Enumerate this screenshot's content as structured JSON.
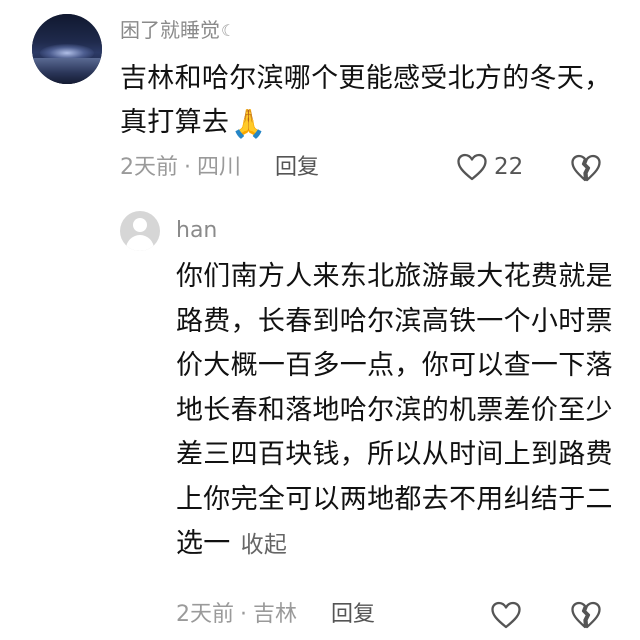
{
  "main_comment": {
    "username": "困了就睡觉",
    "username_icon": "crescent-moon-icon",
    "text": "吉林和哈尔滨哪个更能感受北方的冬天，真打算去",
    "emoji": "🙏",
    "time": "2天前",
    "location": "四川",
    "reply_label": "回复",
    "like_count": "22",
    "like_icon": "heart-outline-icon",
    "dislike_icon": "broken-heart-icon"
  },
  "reply_comment": {
    "username": "han",
    "text": "你们南方人来东北旅游最大花费就是路费，长春到哈尔滨高铁一个小时票价大概一百多一点，你可以查一下落地长春和落地哈尔滨的机票差价至少差三四百块钱，所以从时间上到路费上你完全可以两地都去不用纠结于二选一",
    "collapse_label": "收起",
    "time": "2天前",
    "location": "吉林",
    "reply_label": "回复",
    "like_icon": "heart-outline-icon",
    "dislike_icon": "broken-heart-icon"
  },
  "separator": "·",
  "colors": {
    "meta_gray": "#9a9a9a",
    "text_black": "#111111",
    "icon_gray": "#555555"
  }
}
